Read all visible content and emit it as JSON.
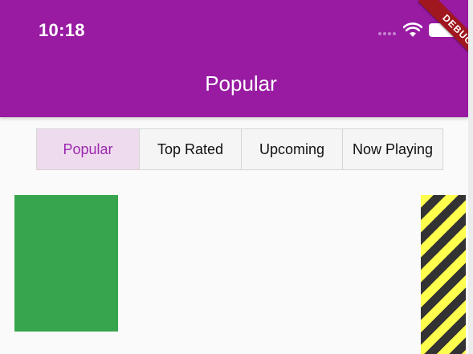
{
  "status_bar": {
    "time": "10:18",
    "icons": [
      "signal-dots-icon",
      "wifi-icon",
      "battery-icon"
    ]
  },
  "debug_banner": {
    "label": "DEBUG"
  },
  "app_bar": {
    "title": "Popular"
  },
  "tabs": [
    {
      "label": "Popular",
      "selected": true
    },
    {
      "label": "Top Rated",
      "selected": false
    },
    {
      "label": "Upcoming",
      "selected": false
    },
    {
      "label": "Now Playing",
      "selected": false
    }
  ],
  "colors": {
    "app_bar": "#981ba2",
    "selected_tab_bg": "#efdbee",
    "selected_tab_text": "#9c27b0",
    "card": "#37a54d",
    "debug_banner": "#a0171f",
    "overflow_stripe_yellow": "#ffff4d",
    "overflow_stripe_dark": "#333333"
  }
}
